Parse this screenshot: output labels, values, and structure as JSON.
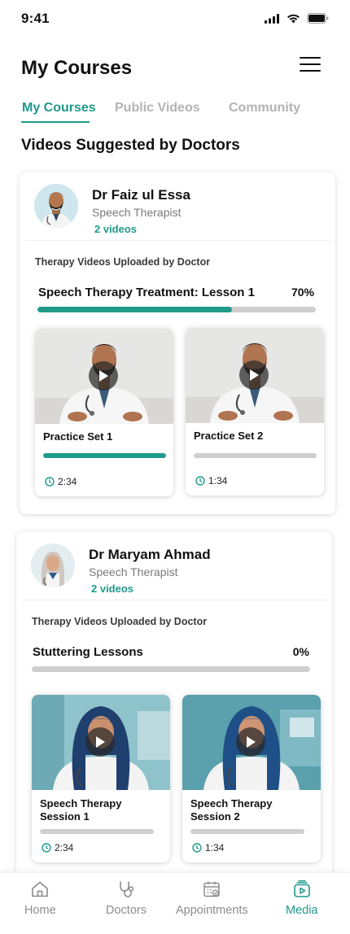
{
  "status": {
    "time": "9:41"
  },
  "header": {
    "title": "My Courses"
  },
  "tabs": [
    {
      "label": "My Courses",
      "active": true
    },
    {
      "label": "Public Videos",
      "active": false
    },
    {
      "label": "Community",
      "active": false
    }
  ],
  "section_title": "Videos Suggested by Doctors",
  "doctors": [
    {
      "name": "Dr Faiz ul Essa",
      "role": "Speech Therapist",
      "videos_count": "2 videos",
      "uploaded_label": "Therapy Videos Uploaded by Doctor",
      "course": {
        "title": "Speech Therapy Treatment: Lesson 1",
        "percent_text": "70%",
        "progress": 0.7
      },
      "videos": [
        {
          "title": "Practice Set 1",
          "duration": "2:34",
          "progress": 1.0
        },
        {
          "title": "Practice Set 2",
          "duration": "1:34",
          "progress": 0.0
        }
      ]
    },
    {
      "name": "Dr Maryam Ahmad",
      "role": "Speech Therapist",
      "videos_count": "2 videos",
      "uploaded_label": "Therapy Videos Uploaded by Doctor",
      "course": {
        "title": "Stuttering Lessons",
        "percent_text": "0%",
        "progress": 0.0
      },
      "videos": [
        {
          "title": "Speech Therapy Session 1",
          "duration": "2:34",
          "progress": 0.0
        },
        {
          "title": "Speech Therapy Session 2",
          "duration": "1:34",
          "progress": 0.0
        }
      ]
    }
  ],
  "bottom_nav": [
    {
      "label": "Home",
      "icon": "home-icon",
      "active": false
    },
    {
      "label": "Doctors",
      "icon": "stethoscope-icon",
      "active": false
    },
    {
      "label": "Appointments",
      "icon": "calendar-icon",
      "active": false
    },
    {
      "label": "Media",
      "icon": "media-icon",
      "active": true
    }
  ],
  "colors": {
    "accent": "#1f9a8a",
    "track": "#cfcfcf",
    "inactive": "#b3b3b3"
  }
}
